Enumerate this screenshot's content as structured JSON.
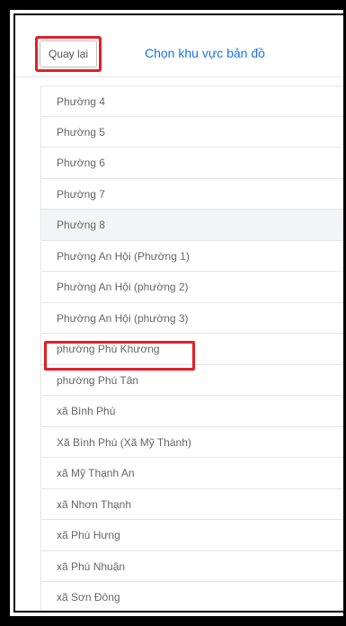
{
  "header": {
    "back_label": "Quay lại",
    "title": "Chọn khu vực bản đồ"
  },
  "list": {
    "items": [
      "Phường 4",
      "Phường 5",
      "Phường 6",
      "Phường 7",
      "Phường 8",
      "Phường An Hội (Phường 1)",
      "Phường An Hội (phường 2)",
      "Phường An Hội (phường 3)",
      "phường Phú Khương",
      "phường Phú Tân",
      "xã Bình Phú",
      "Xã Bình Phú (Xã Mỹ Thành)",
      "xã Mỹ Thạnh An",
      "xã Nhơn Thạnh",
      "xã Phú Hưng",
      "xã Phú Nhuận",
      "xã Sơn Đông"
    ],
    "selected_index": 4,
    "highlighted_index": 8
  },
  "colors": {
    "title": "#1a73e8",
    "highlight": "#e21f26",
    "selected_bg": "#f3f4f6"
  }
}
